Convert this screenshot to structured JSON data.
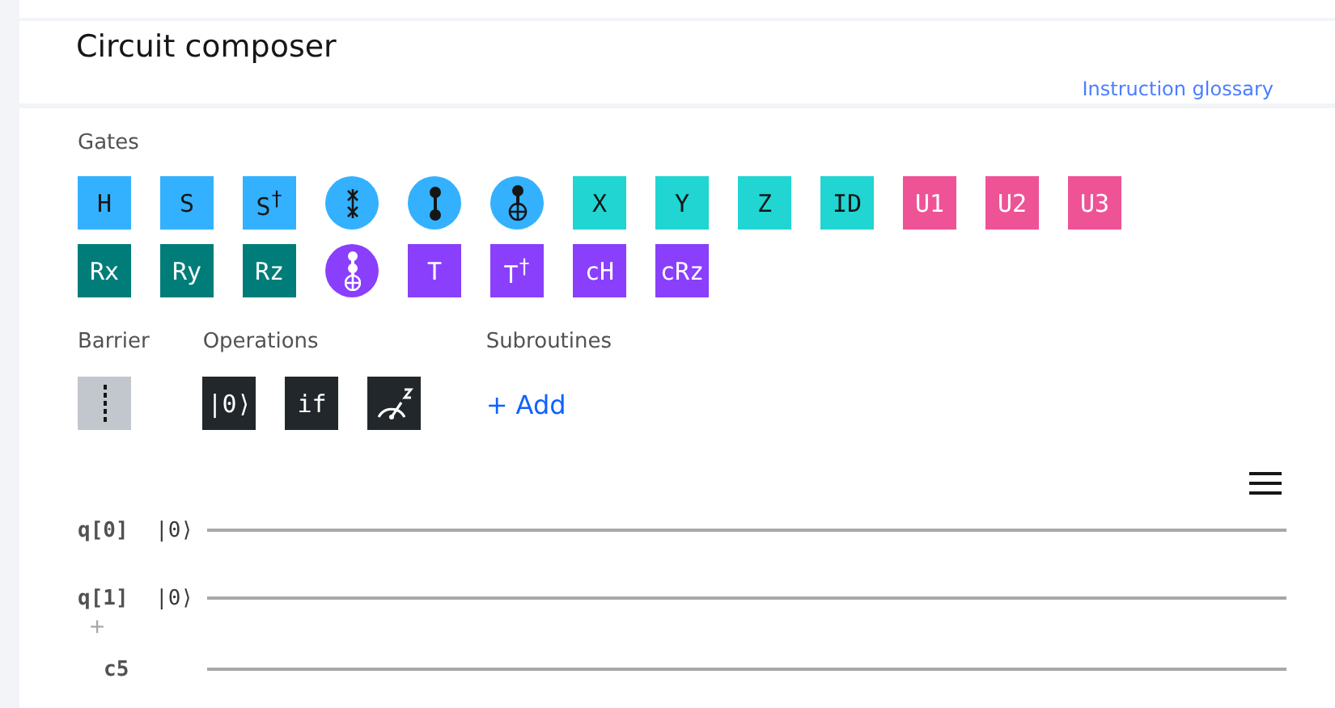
{
  "header": {
    "title": "Circuit composer",
    "link": "Instruction glossary"
  },
  "gates": {
    "label": "Gates",
    "rows": [
      [
        {
          "kind": "text",
          "label": "H",
          "color": "#33b1ff"
        },
        {
          "kind": "text",
          "label": "S",
          "color": "#33b1ff"
        },
        {
          "kind": "text",
          "label": "S$^{†}$",
          "color": "#33b1ff"
        },
        {
          "kind": "swap",
          "color": "#33b1ff"
        },
        {
          "kind": "control-dot",
          "color": "#33b1ff"
        },
        {
          "kind": "control-plus",
          "color": "#33b1ff"
        },
        {
          "kind": "text",
          "label": "X",
          "color": "#20d5d2"
        },
        {
          "kind": "text",
          "label": "Y",
          "color": "#20d5d2"
        },
        {
          "kind": "text",
          "label": "Z",
          "color": "#20d5d2"
        },
        {
          "kind": "text",
          "label": "ID",
          "color": "#20d5d2"
        },
        {
          "kind": "text",
          "label": "U1",
          "color": "#ee5396"
        },
        {
          "kind": "text",
          "label": "U2",
          "color": "#ee5396"
        },
        {
          "kind": "text",
          "label": "U3",
          "color": "#ee5396"
        }
      ],
      [
        {
          "kind": "text",
          "label": "Rx",
          "color": "#007d79"
        },
        {
          "kind": "text",
          "label": "Ry",
          "color": "#007d79"
        },
        {
          "kind": "text",
          "label": "Rz",
          "color": "#007d79"
        },
        {
          "kind": "double-control-plus",
          "color": "#8a3ffc"
        },
        {
          "kind": "text",
          "label": "T",
          "color": "#8a3ffc"
        },
        {
          "kind": "text",
          "label": "T$^{†}$",
          "color": "#8a3ffc"
        },
        {
          "kind": "text",
          "label": "cH",
          "color": "#8a3ffc"
        },
        {
          "kind": "text",
          "label": "cRz",
          "color": "#8a3ffc"
        }
      ]
    ]
  },
  "barrier": {
    "label": "Barrier"
  },
  "operations": {
    "label": "Operations",
    "items": [
      {
        "kind": "text",
        "label": "|0⟩"
      },
      {
        "kind": "text",
        "label": "if"
      },
      {
        "kind": "measure"
      }
    ]
  },
  "subroutines": {
    "label": "Subroutines",
    "add": "+ Add"
  },
  "circuit": {
    "qubits": [
      {
        "label": "q[0]",
        "state": "|0⟩"
      },
      {
        "label": "q[1]",
        "state": "|0⟩"
      }
    ],
    "add": "+",
    "classical": [
      {
        "label": "c5"
      }
    ]
  }
}
